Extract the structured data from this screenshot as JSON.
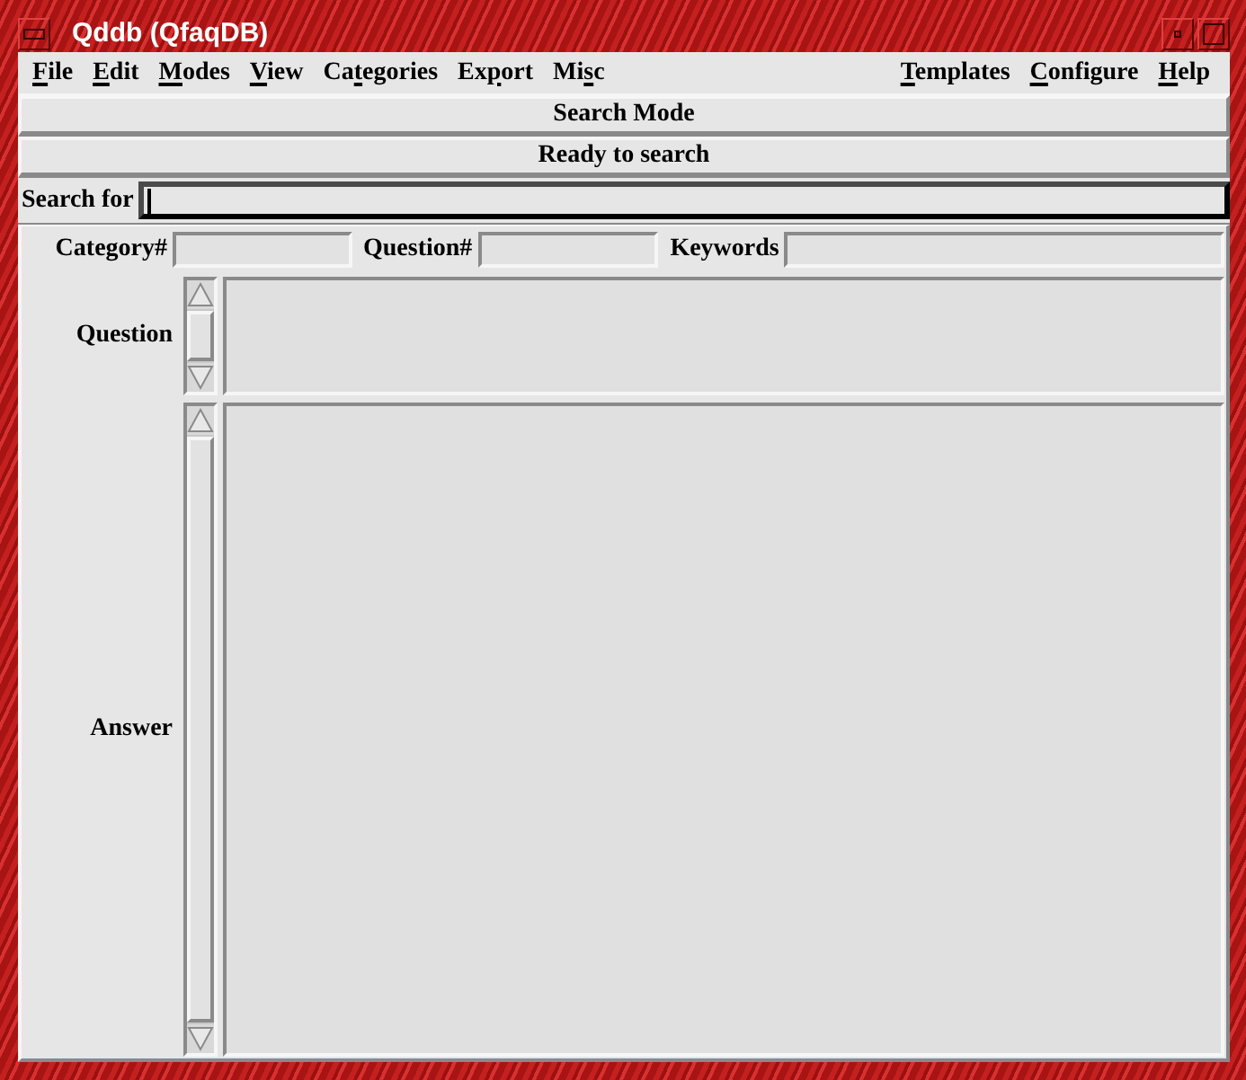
{
  "window": {
    "title": "Qddb (QfaqDB)"
  },
  "menu_left": [
    {
      "key": "F",
      "after": "ile"
    },
    {
      "key": "E",
      "after": "dit"
    },
    {
      "key": "M",
      "after": "odes"
    },
    {
      "key": "V",
      "after": "iew"
    },
    {
      "before": "Ca",
      "key": "t",
      "after": "egories"
    },
    {
      "before": "Ex",
      "key": "p",
      "after": "ort"
    },
    {
      "before": "Mi",
      "key": "s",
      "after": "c"
    }
  ],
  "menu_right": [
    {
      "key": "T",
      "after": "emplates"
    },
    {
      "key": "C",
      "after": "onfigure"
    },
    {
      "key": "H",
      "after": "elp"
    }
  ],
  "mode_bar": {
    "text": "Search Mode"
  },
  "status_bar": {
    "text": "Ready to search"
  },
  "search": {
    "label": "Search for",
    "focused": true
  },
  "fields": [
    {
      "label": "Category#"
    },
    {
      "label": "Question#"
    },
    {
      "label": "Keywords"
    }
  ],
  "panes": [
    {
      "label": "Question",
      "kind": "short"
    },
    {
      "label": "Answer",
      "kind": "tall"
    }
  ]
}
